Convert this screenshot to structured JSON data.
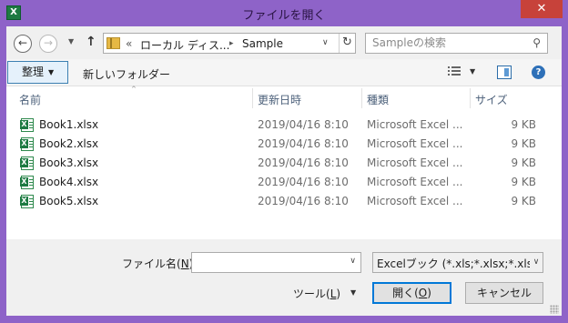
{
  "window": {
    "title": "ファイルを開く",
    "app_icon_letter": "X",
    "close_label": "✕"
  },
  "navigation": {
    "back_icon": "←",
    "forward_icon": "→",
    "recent_dropdown_icon": "▼",
    "up_icon": "↑",
    "breadcrumb_prefix": "«",
    "breadcrumb_parent": "ローカル ディス...",
    "breadcrumb_separator": "▸",
    "breadcrumb_current": "Sample",
    "refresh_icon": "↻"
  },
  "search": {
    "placeholder": "Sampleの検索",
    "icon": "⚲"
  },
  "toolbar": {
    "organize_label": "整理",
    "new_folder_label": "新しいフォルダー",
    "view_dropdown_icon": "▼",
    "help_label": "?"
  },
  "file_list": {
    "sort_indicator": "^",
    "columns": {
      "name": "名前",
      "date": "更新日時",
      "type": "種類",
      "size": "サイズ"
    },
    "files": [
      {
        "name": "Book1.xlsx",
        "date": "2019/04/16 8:10",
        "type": "Microsoft Excel ...",
        "size": "9 KB"
      },
      {
        "name": "Book2.xlsx",
        "date": "2019/04/16 8:10",
        "type": "Microsoft Excel ...",
        "size": "9 KB"
      },
      {
        "name": "Book3.xlsx",
        "date": "2019/04/16 8:10",
        "type": "Microsoft Excel ...",
        "size": "9 KB"
      },
      {
        "name": "Book4.xlsx",
        "date": "2019/04/16 8:10",
        "type": "Microsoft Excel ...",
        "size": "9 KB"
      },
      {
        "name": "Book5.xlsx",
        "date": "2019/04/16 8:10",
        "type": "Microsoft Excel ...",
        "size": "9 KB"
      }
    ]
  },
  "bottom": {
    "filename_label_pre": "ファイル名(",
    "filename_label_key": "N",
    "filename_label_post": "):",
    "filename_value": "",
    "filter_value": "Excelブック (*.xls;*.xlsx;*.xlsm",
    "tools_label_pre": "ツール(",
    "tools_label_key": "L",
    "tools_label_post": ")",
    "open_label_pre": "開く(",
    "open_label_key": "O",
    "open_label_post": ")",
    "cancel_label": "キャンセル"
  },
  "colors": {
    "frame": "#8e63c8",
    "close": "#c7423a",
    "accent": "#0078d7"
  }
}
